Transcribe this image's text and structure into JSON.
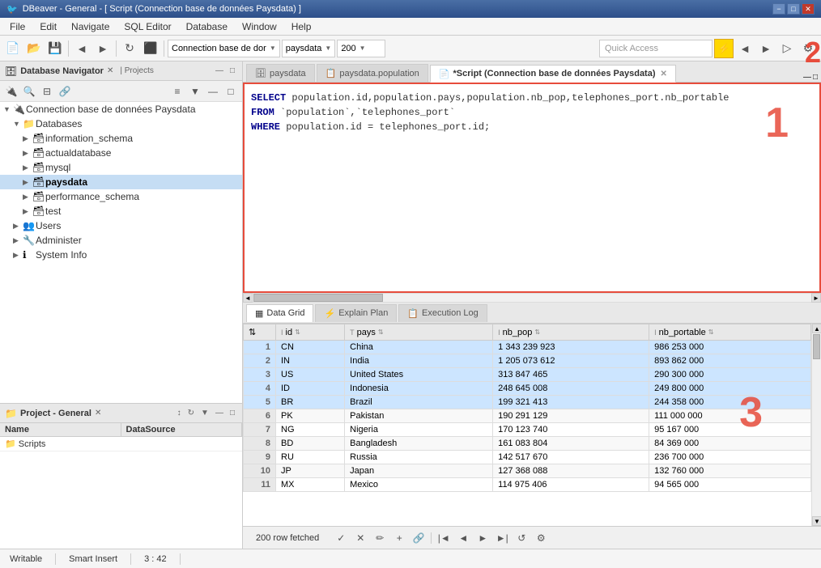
{
  "titleBar": {
    "title": "DBeaver - General - [ Script (Connection base de données Paysdata) ]",
    "icon": "🐦",
    "controls": [
      "−",
      "□",
      "✕"
    ]
  },
  "menuBar": {
    "items": [
      "File",
      "Edit",
      "Navigate",
      "SQL Editor",
      "Database",
      "Window",
      "Help"
    ]
  },
  "toolbar": {
    "quickAccess": {
      "placeholder": "Quick Access"
    },
    "connectionDropdown": "Connection base de dor",
    "dbDropdown": "paysdata",
    "limitValue": "200"
  },
  "editorTabs": [
    {
      "id": "paysdata",
      "label": "paysdata",
      "active": false,
      "icon": "🗄"
    },
    {
      "id": "population",
      "label": "paysdata.population",
      "active": false,
      "icon": "📋"
    },
    {
      "id": "script",
      "label": "*Script (Connection base de données Paysdata)",
      "active": true,
      "icon": "📄",
      "closable": true
    }
  ],
  "sqlEditor": {
    "lines": [
      "SELECT population.id,population.pays,population.nb_pop,telephones_port.nb_portable",
      "FROM `population`,`telephones_port`",
      "WHERE population.id = telephones_port.id;"
    ],
    "redLabel": "1"
  },
  "resultTabs": [
    {
      "label": "Data Grid",
      "icon": "▦",
      "active": true
    },
    {
      "label": "Explain Plan",
      "icon": "⚡",
      "active": false
    },
    {
      "label": "Execution Log",
      "icon": "📋",
      "active": false
    }
  ],
  "dataGrid": {
    "columns": [
      {
        "name": "",
        "type": ""
      },
      {
        "name": "id",
        "type": "I"
      },
      {
        "name": "pays",
        "type": "T"
      },
      {
        "name": "nb_pop",
        "type": "I"
      },
      {
        "name": "nb_portable",
        "type": "I"
      }
    ],
    "rows": [
      {
        "num": "1",
        "id": "CN",
        "pays": "China",
        "nb_pop": "1 343 239 923",
        "nb_portable": "986 253 000",
        "highlighted": true
      },
      {
        "num": "2",
        "id": "IN",
        "pays": "India",
        "nb_pop": "1 205 073 612",
        "nb_portable": "893 862 000",
        "highlighted": true
      },
      {
        "num": "3",
        "id": "US",
        "pays": "United States",
        "nb_pop": "313 847 465",
        "nb_portable": "290 300 000",
        "highlighted": true
      },
      {
        "num": "4",
        "id": "ID",
        "pays": "Indonesia",
        "nb_pop": "248 645 008",
        "nb_portable": "249 800 000",
        "highlighted": true
      },
      {
        "num": "5",
        "id": "BR",
        "pays": "Brazil",
        "nb_pop": "199 321 413",
        "nb_portable": "244 358 000",
        "highlighted": true
      },
      {
        "num": "6",
        "id": "PK",
        "pays": "Pakistan",
        "nb_pop": "190 291 129",
        "nb_portable": "111 000 000",
        "highlighted": false
      },
      {
        "num": "7",
        "id": "NG",
        "pays": "Nigeria",
        "nb_pop": "170 123 740",
        "nb_portable": "95 167 000",
        "highlighted": false
      },
      {
        "num": "8",
        "id": "BD",
        "pays": "Bangladesh",
        "nb_pop": "161 083 804",
        "nb_portable": "84 369 000",
        "highlighted": false
      },
      {
        "num": "9",
        "id": "RU",
        "pays": "Russia",
        "nb_pop": "142 517 670",
        "nb_portable": "236 700 000",
        "highlighted": false
      },
      {
        "num": "10",
        "id": "JP",
        "pays": "Japan",
        "nb_pop": "127 368 088",
        "nb_portable": "132 760 000",
        "highlighted": false
      },
      {
        "num": "11",
        "id": "MX",
        "pays": "Mexico",
        "nb_pop": "114 975 406",
        "nb_portable": "94 565 000",
        "highlighted": false
      }
    ],
    "redLabel": "3",
    "rowCount": "200 row fetched"
  },
  "dbNavigator": {
    "title": "Database Navigator",
    "tree": {
      "root": "Connection base de données Paysdata",
      "databases": {
        "label": "Databases",
        "children": [
          {
            "label": "information_schema",
            "icon": "📁"
          },
          {
            "label": "actualdatabase",
            "icon": "📁"
          },
          {
            "label": "mysql",
            "icon": "📁"
          },
          {
            "label": "paysdata",
            "icon": "📁",
            "bold": true,
            "selected": true
          },
          {
            "label": "performance_schema",
            "icon": "📁"
          },
          {
            "label": "test",
            "icon": "📁"
          }
        ]
      },
      "otherItems": [
        {
          "label": "Users",
          "icon": "👥"
        },
        {
          "label": "Administer",
          "icon": "🔧"
        },
        {
          "label": "System Info",
          "icon": "ℹ"
        }
      ]
    }
  },
  "projectPanel": {
    "title": "Project - General",
    "columns": [
      "Name",
      "DataSource"
    ],
    "rows": [
      {
        "name": "Scripts",
        "icon": "📁",
        "datasource": ""
      }
    ]
  },
  "statusBar": {
    "rowCount": "200 row fetched",
    "buttons": [
      "✓",
      "✕",
      "✏",
      "+",
      "🔗",
      "|◄",
      "◄",
      "►",
      "►|",
      "↺",
      "⚙"
    ]
  },
  "bottomStatus": {
    "writable": "Writable",
    "smartInsert": "Smart Insert",
    "position": "3 : 42"
  }
}
